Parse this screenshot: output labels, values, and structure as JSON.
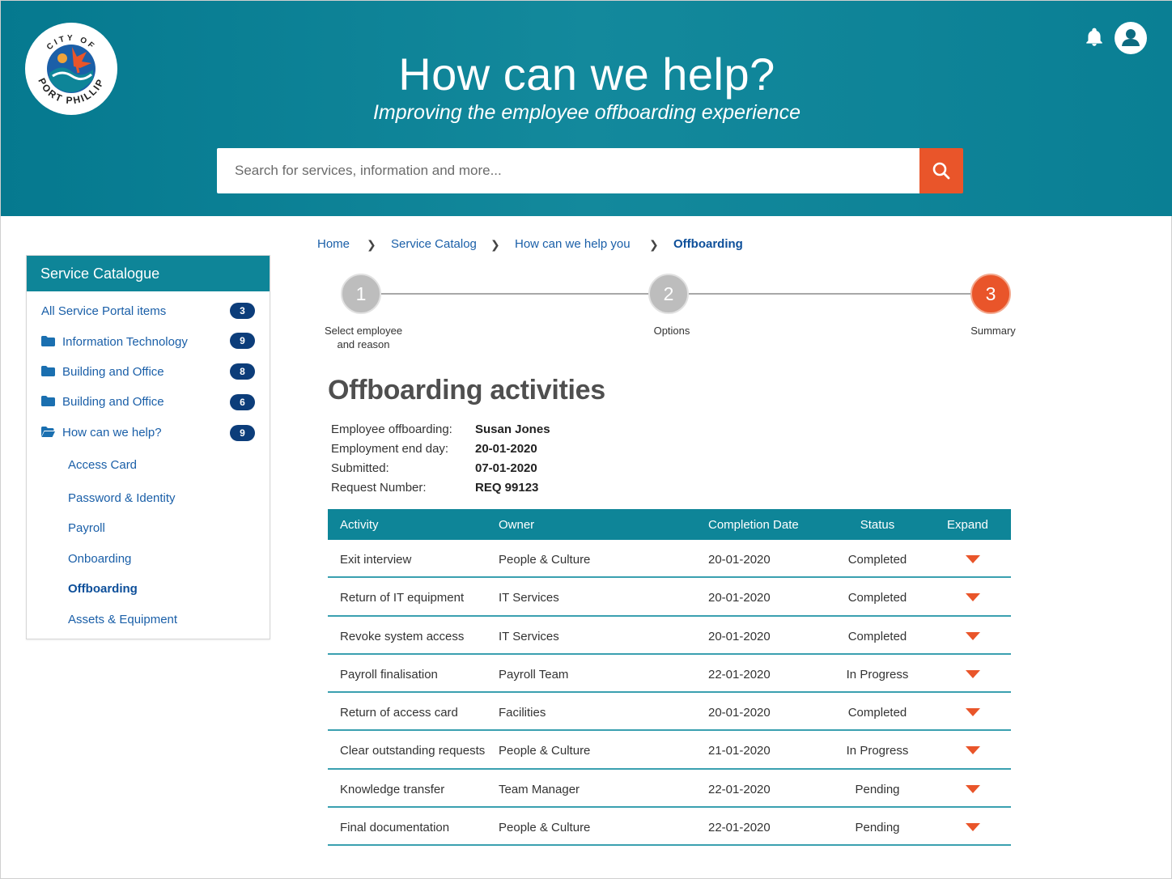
{
  "header": {
    "logo_text_top": "CITY OF",
    "logo_text_bottom": "PORT PHILLIP",
    "title": "How can we help?",
    "subtitle": "Improving the employee offboarding experience",
    "search_placeholder": "Search for services, information and more...",
    "icons": [
      "bell-icon",
      "user-icon",
      "search-icon"
    ]
  },
  "sidebar": {
    "title": "Service Catalogue",
    "items": [
      {
        "label": "All Service Portal items",
        "count": "3",
        "icon": ""
      },
      {
        "label": "Information Technology",
        "count": "9",
        "icon": "folder-icon"
      },
      {
        "label": "Building and Office",
        "count": "8",
        "icon": "folder-icon"
      },
      {
        "label": "Building and Office",
        "count": "6",
        "icon": "folder-icon"
      },
      {
        "label": "How can we help?",
        "count": "9",
        "icon": "folder-open-icon"
      }
    ],
    "subitems": [
      {
        "label": "Access Card"
      },
      {
        "label": "Password & Identity"
      },
      {
        "label": "Payroll"
      },
      {
        "label": "Onboarding"
      },
      {
        "label": "Offboarding",
        "active": true
      },
      {
        "label": "Assets & Equipment"
      }
    ]
  },
  "breadcrumb": [
    "Home",
    "Service Catalog",
    "How can we help you",
    "Offboarding"
  ],
  "stepper": [
    {
      "number": "1",
      "label_line1": "Select employee",
      "label_line2": "and reason"
    },
    {
      "number": "2",
      "label_line1": "Options",
      "label_line2": ""
    },
    {
      "number": "3",
      "label_line1": "Summary",
      "label_line2": "",
      "current": true
    }
  ],
  "content": {
    "title": "Offboarding activities",
    "info": [
      {
        "label": "Employee offboarding:",
        "value": "Susan Jones"
      },
      {
        "label": "Employment end day:",
        "value": "20-01-2020"
      },
      {
        "label": "Submitted:",
        "value": "07-01-2020"
      },
      {
        "label": "Request Number:",
        "value": "REQ 99123"
      }
    ]
  },
  "table": {
    "columns": [
      "Activity",
      "Owner",
      "Completion Date",
      "Status",
      "Expand"
    ],
    "rows": [
      {
        "activity": "Exit interview",
        "owner": "People & Culture",
        "date": "20-01-2020",
        "status": "Completed"
      },
      {
        "activity": "Return of IT equipment",
        "owner": "IT Services",
        "date": "20-01-2020",
        "status": "Completed"
      },
      {
        "activity": "Revoke system access",
        "owner": "IT Services",
        "date": "20-01-2020",
        "status": "Completed"
      },
      {
        "activity": "Payroll finalisation",
        "owner": "Payroll Team",
        "date": "22-01-2020",
        "status": "In Progress"
      },
      {
        "activity": "Return of access card",
        "owner": "Facilities",
        "date": "20-01-2020",
        "status": "Completed"
      },
      {
        "activity": "Clear outstanding requests",
        "owner": "People & Culture",
        "date": "21-01-2020",
        "status": "In Progress"
      },
      {
        "activity": "Knowledge transfer",
        "owner": "Team Manager",
        "date": "22-01-2020",
        "status": "Pending"
      },
      {
        "activity": "Final documentation",
        "owner": "People & Culture",
        "date": "22-01-2020",
        "status": "Pending"
      }
    ]
  },
  "colors": {
    "brand_teal": "#0e8598",
    "accent_orange": "#e9552a",
    "link_blue": "#1a5fa8",
    "badge_navy": "#0c3d7a"
  }
}
